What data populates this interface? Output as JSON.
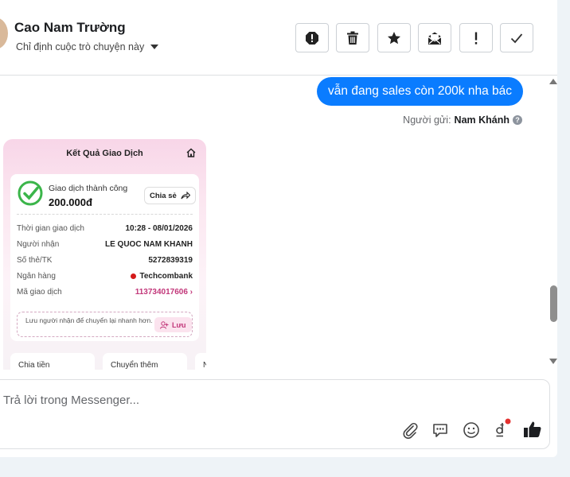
{
  "header": {
    "contact_name": "Cao Nam Trường",
    "assign_label": "Chỉ định cuộc trò chuyện này",
    "toolbar": [
      {
        "name": "spam-button",
        "icon": "alert-octagon-icon"
      },
      {
        "name": "delete-button",
        "icon": "trash-icon"
      },
      {
        "name": "star-button",
        "icon": "star-icon"
      },
      {
        "name": "mark-unread-button",
        "icon": "envelope-open-icon"
      },
      {
        "name": "follow-up-button",
        "icon": "exclamation-icon"
      },
      {
        "name": "mark-done-button",
        "icon": "check-icon"
      }
    ]
  },
  "messages": {
    "outgoing_text": "vẫn đang sales còn 200k nha bác",
    "sender_prefix": "Người gửi:",
    "sender_name": "Nam Khánh"
  },
  "receipt": {
    "title": "Kết Quả Giao Dịch",
    "status": "Giao dịch thành công",
    "amount": "200.000đ",
    "share_label": "Chia sẻ",
    "rows": [
      {
        "label": "Thời gian giao dịch",
        "value": "10:28 - 08/01/2026"
      },
      {
        "label": "Người nhận",
        "value": "LE QUOC NAM KHANH"
      },
      {
        "label": "Số thẻ/TK",
        "value": "5272839319"
      },
      {
        "label": "Ngân hàng",
        "value": "Techcombank"
      },
      {
        "label": "Mã giao dịch",
        "value": "113734017606"
      }
    ],
    "note": "Lưu người nhận để chuyển lại nhanh hơn.",
    "save_label": "Lưu",
    "actions": [
      "Chia tiền",
      "Chuyển thêm",
      "N"
    ]
  },
  "composer": {
    "placeholder": "Trả lời trong Messenger..."
  },
  "colors": {
    "accent": "#0a7cff",
    "receipt_pink": "#c2377a",
    "success_green": "#3bb54a"
  }
}
